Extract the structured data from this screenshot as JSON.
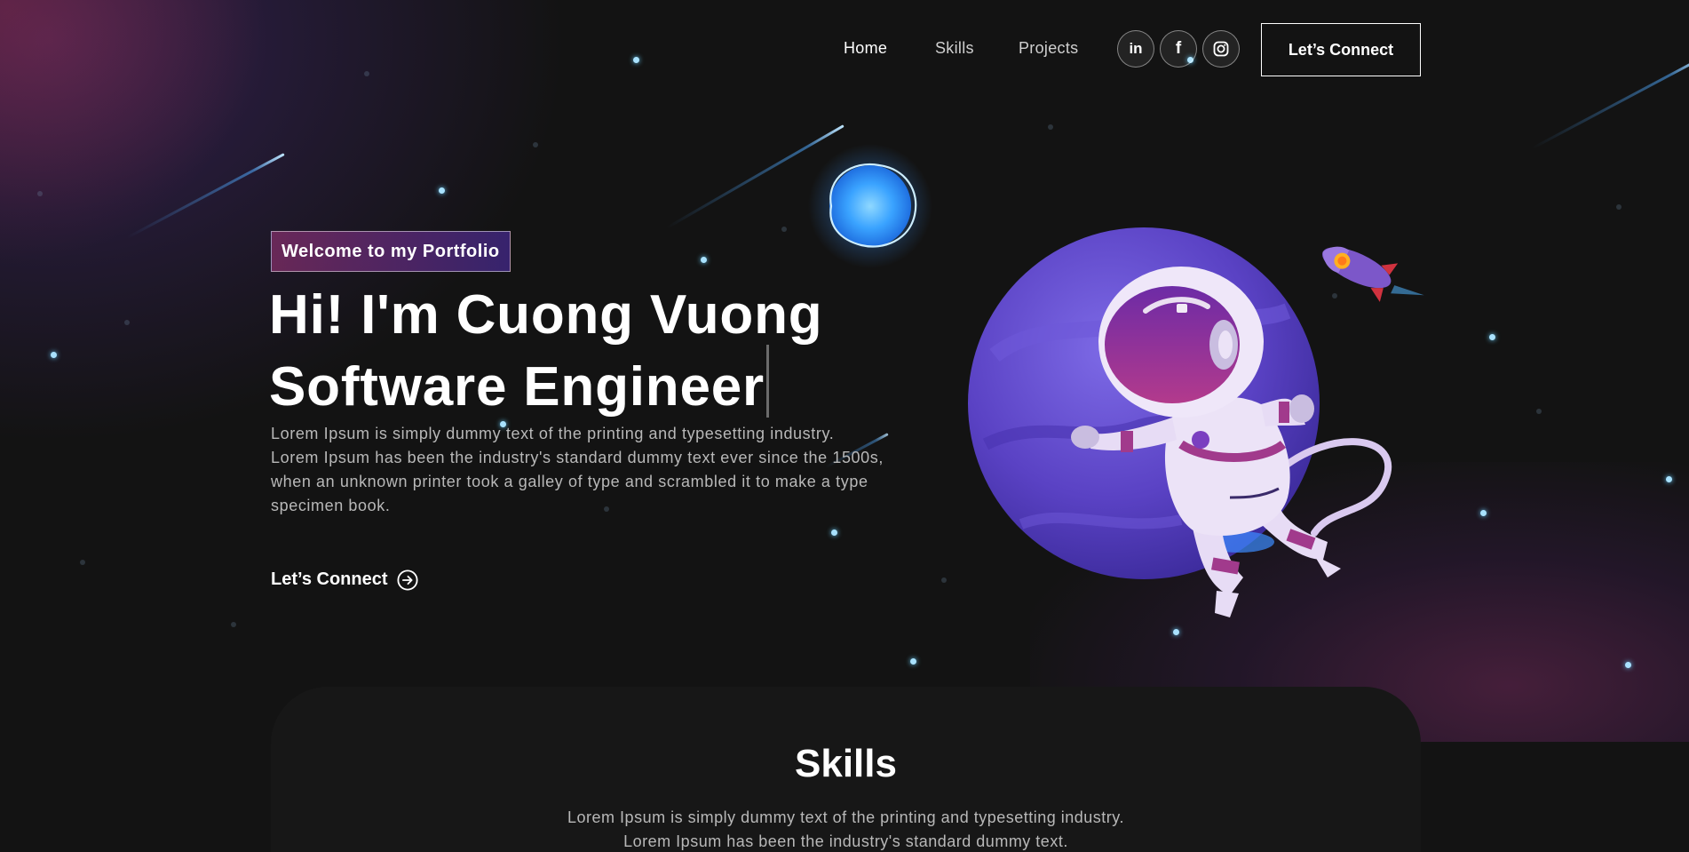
{
  "nav": {
    "links": [
      {
        "label": "Home",
        "active": true
      },
      {
        "label": "Skills",
        "active": false
      },
      {
        "label": "Projects",
        "active": false
      }
    ],
    "social": [
      {
        "icon": "linkedin-icon",
        "glyph": "in"
      },
      {
        "icon": "facebook-icon",
        "glyph": "f"
      },
      {
        "icon": "instagram-icon",
        "glyph": ""
      }
    ],
    "cta_label": "Let’s Connect"
  },
  "hero": {
    "tagline": "Welcome to my Portfolio",
    "title_line1": "Hi! I'm Cuong Vuong",
    "title_line2": "Software Engineer",
    "description": "Lorem Ipsum is simply dummy text of the printing and typesetting industry. Lorem Ipsum has been the industry's standard dummy text ever since the 1500s, when an unknown printer took a galley of type and scrambled it to make a type specimen book.",
    "connect_label": "Let’s Connect",
    "connect_icon": "arrow-right-circle-icon"
  },
  "skills": {
    "title": "Skills",
    "desc_line1": "Lorem Ipsum is simply dummy text of the printing and typesetting industry.",
    "desc_line2": "Lorem Ipsum has been the industry's standard dummy text."
  },
  "colors": {
    "background": "#131313",
    "tagline_gradient_start": "#AA367C",
    "tagline_gradient_end": "#4A2FBD",
    "planet": "#6a4fd0",
    "text_muted": "#B8B8B8"
  }
}
